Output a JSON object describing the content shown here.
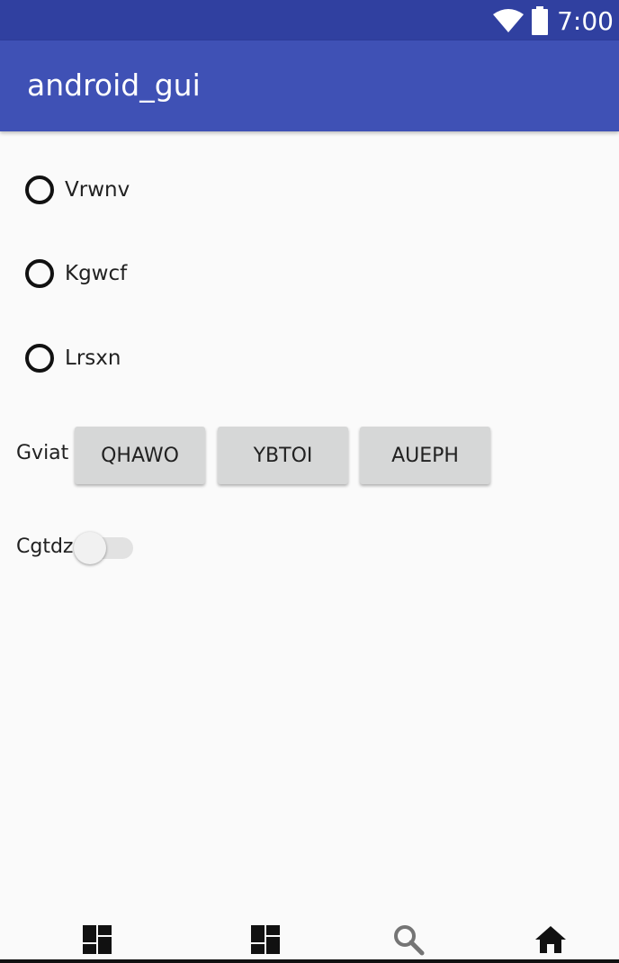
{
  "status_bar": {
    "time": "7:00",
    "icons": [
      "wifi-icon",
      "battery-icon"
    ],
    "color": "#3040a0"
  },
  "app_bar": {
    "title": "android_gui",
    "color": "#3f51b5"
  },
  "radios": [
    {
      "label": "Vrwnv",
      "selected": false
    },
    {
      "label": "Kgwcf",
      "selected": false
    },
    {
      "label": "Lrsxn",
      "selected": false
    }
  ],
  "button_group": {
    "label": "Gviat",
    "buttons": [
      "QHAWO",
      "YBTOI",
      "AUEPH"
    ]
  },
  "switch": {
    "label": "Cgtdz",
    "checked": false
  },
  "bottom_nav": {
    "items": [
      "dashboard-icon",
      "dashboard-icon",
      "search-icon",
      "home-icon"
    ],
    "active": 3
  }
}
